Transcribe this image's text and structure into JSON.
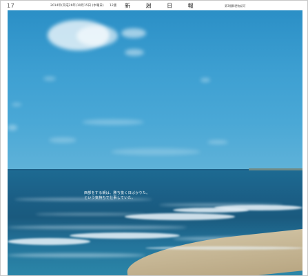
{
  "header": {
    "page_number": "17",
    "date": "2014年(平成26年)10月15日 (水曜日)",
    "edition": "12版",
    "masthead": "新 潟 日 報",
    "note": "第3種郵便物認可"
  },
  "photo": {
    "caption_line1": "西部をする朝は、勝ち抜く日ばかりた。",
    "caption_line2": "という気持ちで仕事していた。"
  },
  "colors": {
    "sky": "#3ea0d2",
    "sea": "#1b5f86",
    "sand": "#c4b38f"
  }
}
